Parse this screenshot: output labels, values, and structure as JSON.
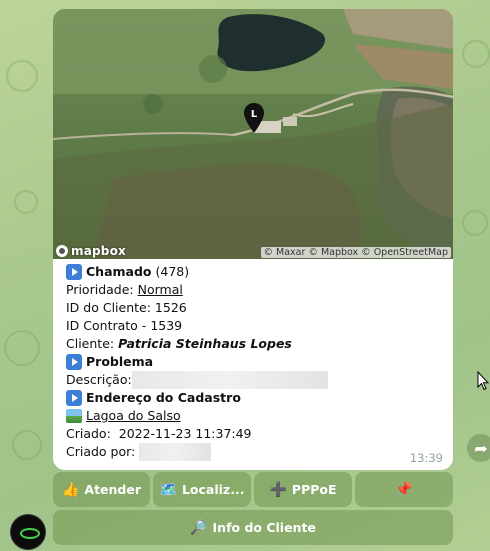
{
  "map": {
    "attribution": "© Maxar © Mapbox © OpenStreetMap",
    "logo_text": "mapbox",
    "pin_label": "L"
  },
  "message": {
    "chamado_label": "Chamado",
    "chamado_count": "(478)",
    "prioridade_label": "Prioridade:",
    "prioridade_value": "Normal",
    "id_cliente_label": "ID do Cliente:",
    "id_cliente_value": "1526",
    "id_contrato_label": "ID Contrato -",
    "id_contrato_value": "1539",
    "cliente_label": "Cliente:",
    "cliente_value": "Patricia Steinhaus Lopes",
    "problema_label": "Problema",
    "descricao_label": "Descrição:",
    "endereco_label": "Endereço do Cadastro",
    "endereco_value": "Lagoa do Salso",
    "criado_label": "Criado:",
    "criado_value": "2022-11-23 11:37:49",
    "criado_por_label": "Criado por:",
    "time": "13:39"
  },
  "keyboard": {
    "atender": "Atender",
    "localizacao": "Localiz...",
    "pppoe": "PPPoE",
    "info_cliente": "Info do Cliente"
  },
  "icons": {
    "atender": "thumbs-up-icon",
    "localizacao": "map-icon",
    "pppoe": "plus-icon",
    "pin": "pushpin-icon",
    "info": "magnifier-icon"
  },
  "colors": {
    "link": "#111111",
    "play_icon": "#3b7fd6",
    "keyboard_button": "#7f9a5a"
  }
}
